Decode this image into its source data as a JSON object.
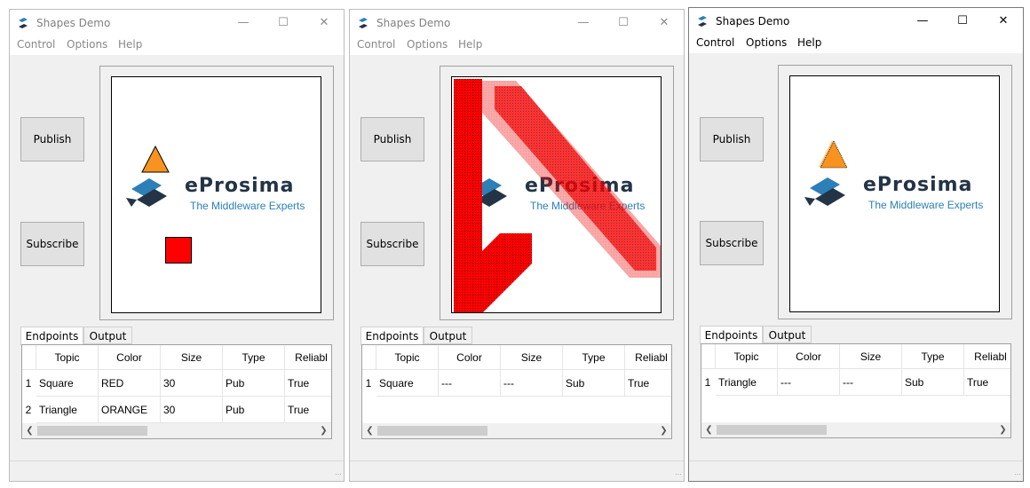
{
  "windows": [
    {
      "title": "Shapes Demo",
      "menu": [
        "Control",
        "Options",
        "Help"
      ],
      "buttons": {
        "publish": "Publish",
        "subscribe": "Subscribe"
      },
      "logo": {
        "name": "eProsima",
        "tagline": "The Middleware Experts"
      },
      "tabs": [
        "Endpoints",
        "Output"
      ],
      "columns": [
        "Topic",
        "Color",
        "Size",
        "Type",
        "Reliabl"
      ],
      "rows": [
        {
          "num": "1",
          "cells": [
            "Square",
            "RED",
            "30",
            "Pub",
            "True"
          ]
        },
        {
          "num": "2",
          "cells": [
            "Triangle",
            "ORANGE",
            "30",
            "Pub",
            "True"
          ]
        }
      ]
    },
    {
      "title": "Shapes Demo",
      "menu": [
        "Control",
        "Options",
        "Help"
      ],
      "buttons": {
        "publish": "Publish",
        "subscribe": "Subscribe"
      },
      "logo": {
        "name": "eProsima",
        "tagline": "The Middleware Experts"
      },
      "tabs": [
        "Endpoints",
        "Output"
      ],
      "columns": [
        "Topic",
        "Color",
        "Size",
        "Type",
        "Reliabl"
      ],
      "rows": [
        {
          "num": "1",
          "cells": [
            "Square",
            "---",
            "---",
            "Sub",
            "True"
          ]
        }
      ]
    },
    {
      "title": "Shapes Demo",
      "menu": [
        "Control",
        "Options",
        "Help"
      ],
      "buttons": {
        "publish": "Publish",
        "subscribe": "Subscribe"
      },
      "logo": {
        "name": "eProsima",
        "tagline": "The Middleware Experts"
      },
      "tabs": [
        "Endpoints",
        "Output"
      ],
      "columns": [
        "Topic",
        "Color",
        "Size",
        "Type",
        "Reliabl"
      ],
      "rows": [
        {
          "num": "1",
          "cells": [
            "Triangle",
            "---",
            "---",
            "Sub",
            "True"
          ]
        }
      ]
    }
  ],
  "colors": {
    "red_shape": "#ff0000",
    "orange_shape": "#f7931e",
    "logo_dark": "#243447",
    "logo_blue": "#2d7fb8"
  },
  "icons": {
    "app": "shapes-demo-icon",
    "minimize": "minimize-icon",
    "maximize": "maximize-icon",
    "close": "close-icon"
  }
}
